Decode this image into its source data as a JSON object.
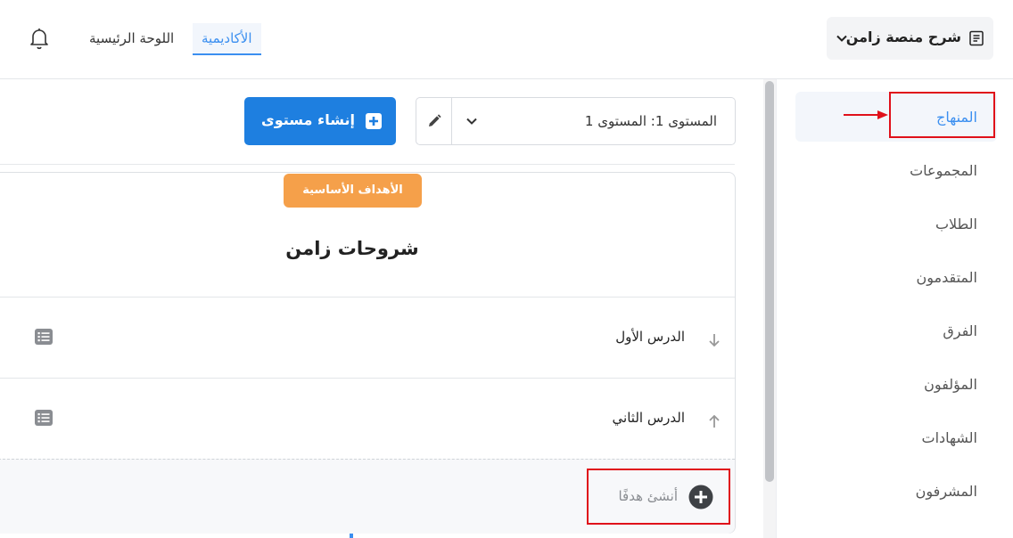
{
  "header": {
    "nav": [
      {
        "label": "اللوحة الرئيسية",
        "active": false
      },
      {
        "label": "الأكاديمية",
        "active": true
      }
    ],
    "platform_selector": "شرح منصة زامن",
    "bell_icon": "bell-icon",
    "accent_color": "#3b8ff0"
  },
  "sidebar": {
    "items": [
      {
        "label": "المنهاج",
        "active": true
      },
      {
        "label": "المجموعات"
      },
      {
        "label": "الطلاب"
      },
      {
        "label": "المتقدمون"
      },
      {
        "label": "الفرق"
      },
      {
        "label": "المؤلفون"
      },
      {
        "label": "الشهادات"
      },
      {
        "label": "المشرفون"
      }
    ]
  },
  "toolbar": {
    "level_value": "المستوى 1: المستوى 1",
    "create_level_label": "إنشاء مستوى",
    "create_level_color": "#1e7fe0"
  },
  "card": {
    "badge": "الأهداف الأساسية",
    "badge_color": "#f5a04a",
    "title": "شروحات زامن",
    "lessons": [
      {
        "label": "الدرس الأول",
        "arrow": "down"
      },
      {
        "label": "الدرس الثاني",
        "arrow": "up"
      }
    ],
    "add_goal_label": "أنشئ هدفًا"
  },
  "annotations": {
    "highlight_color": "#e0101a"
  }
}
